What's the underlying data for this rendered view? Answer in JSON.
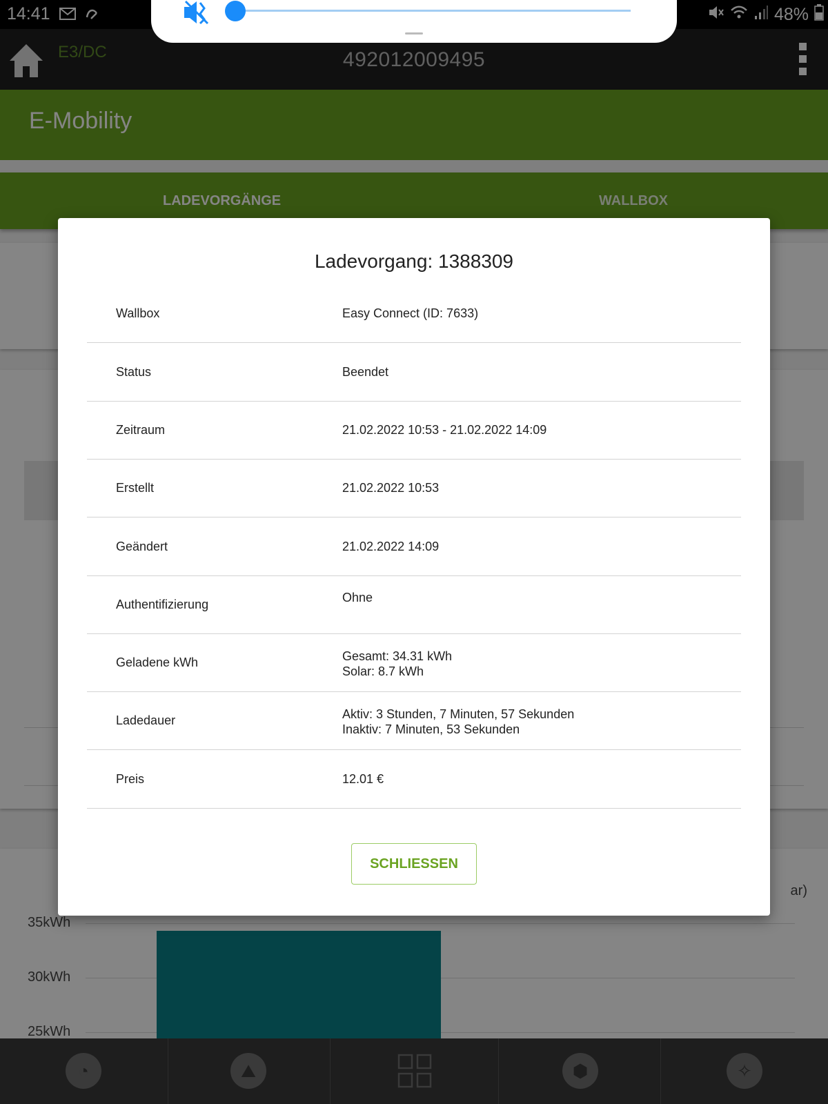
{
  "status_bar": {
    "time": "14:41",
    "battery": "48%"
  },
  "app_bar": {
    "logo": "E3/DC",
    "serial": "492012009495"
  },
  "page": {
    "title": "E-Mobility",
    "tabs": [
      {
        "label": "LADEVORGÄNGE",
        "active": true
      },
      {
        "label": "WALLBOX",
        "active": false
      }
    ]
  },
  "chart": {
    "y_ticks": [
      "35kWh",
      "30kWh",
      "25kWh"
    ],
    "legend_fragment": "ar)"
  },
  "chart_data": {
    "type": "bar",
    "categories": [
      ""
    ],
    "values": [
      34.31
    ],
    "ylabel": "",
    "ytick_labels": [
      "35kWh",
      "30kWh",
      "25kWh"
    ]
  },
  "dialog": {
    "title": "Ladevorgang: 1388309",
    "rows": [
      {
        "label": "Wallbox",
        "value": "Easy Connect (ID: 7633)"
      },
      {
        "label": "Status",
        "value": "Beendet"
      },
      {
        "label": "Zeitraum",
        "value": "21.02.2022 10:53 - 21.02.2022 14:09"
      },
      {
        "label": "Erstellt",
        "value": "21.02.2022 10:53"
      },
      {
        "label": "Geändert",
        "value": "21.02.2022 14:09"
      },
      {
        "label": "Authentifizierung",
        "value": "Ohne"
      },
      {
        "label": "Geladene kWh",
        "value": "Gesamt: 34.31 kWh",
        "value2": "Solar: 8.7 kWh"
      },
      {
        "label": "Ladedauer",
        "value": "Aktiv: 3 Stunden, 7 Minuten, 57 Sekunden",
        "value2": "Inaktiv: 7 Minuten, 53 Sekunden"
      },
      {
        "label": "Preis",
        "value": "12.01 €"
      }
    ],
    "close_label": "SCHLIESSEN"
  },
  "volume": {
    "level": 0.0,
    "muted": true
  },
  "icons": {
    "nav": [
      "gauge-icon",
      "chart-icon",
      "grid-icon",
      "cubes-icon",
      "bulb-icon"
    ]
  }
}
